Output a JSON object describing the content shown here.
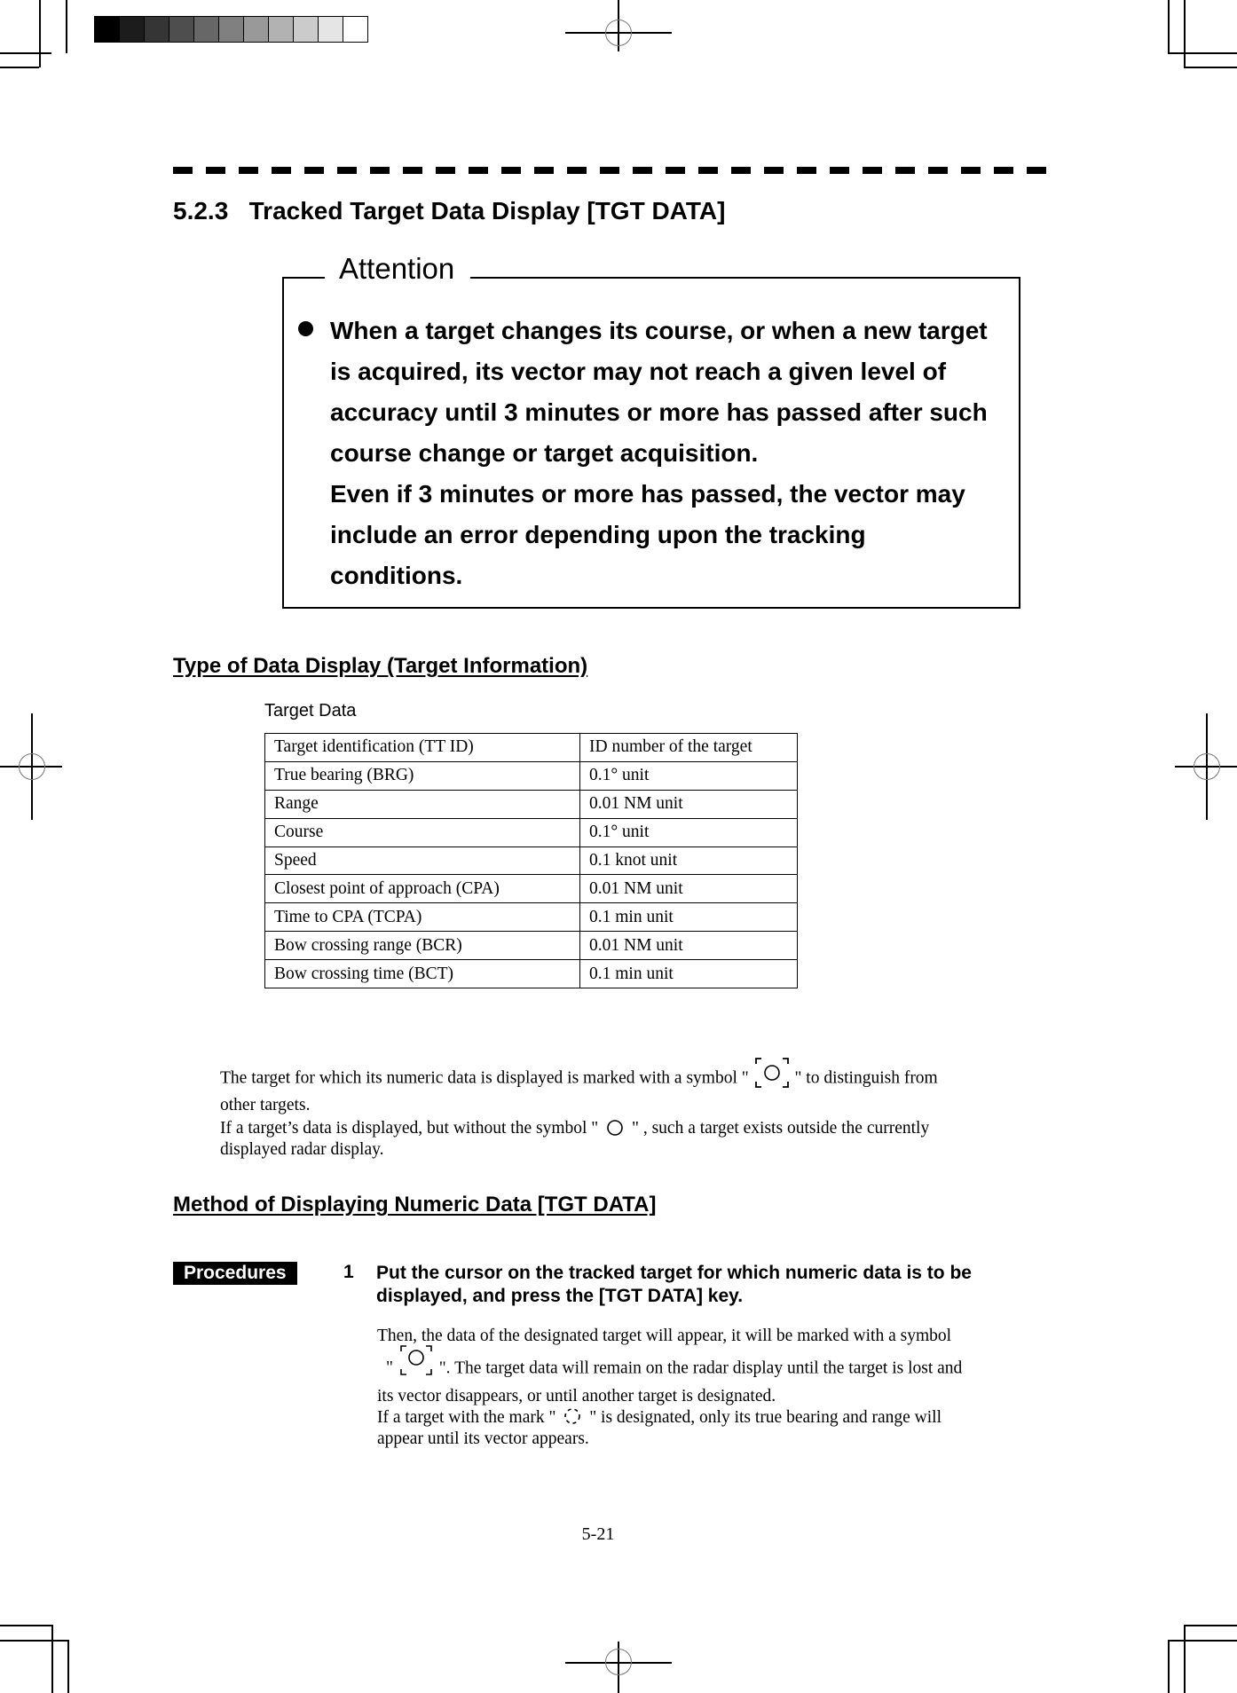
{
  "grayscale_bar": {
    "swatches": [
      "#000000",
      "#1c1c1c",
      "#353535",
      "#4e4e4e",
      "#676767",
      "#808080",
      "#999999",
      "#b2b2b2",
      "#cbcbcb",
      "#e5e5e5",
      "#ffffff"
    ]
  },
  "section": {
    "number": "5.2.3",
    "title": "Tracked Target Data Display [TGT DATA]"
  },
  "attention": {
    "label": "Attention",
    "lines": [
      "When a target changes its course, or when a new target",
      "is acquired, its vector may not reach a given level of",
      "accuracy until 3 minutes or more has passed after such",
      "course change or target acquisition.",
      "Even if 3 minutes or more has passed, the vector may",
      "include an error depending upon the tracking",
      "conditions."
    ]
  },
  "data_display": {
    "heading": "Type of Data Display (Target Information)",
    "caption": "Target Data",
    "rows": [
      {
        "item": "Target identification (TT ID)",
        "value": "ID number of the target"
      },
      {
        "item": "True bearing (BRG)",
        "value": "0.1° unit"
      },
      {
        "item": "Range",
        "value": "0.01 NM unit"
      },
      {
        "item": "Course",
        "value": "0.1° unit"
      },
      {
        "item": "Speed",
        "value": "0.1 knot unit"
      },
      {
        "item": "Closest point of approach (CPA)",
        "value": "0.01 NM unit"
      },
      {
        "item": "Time to CPA (TCPA)",
        "value": "0.1 min unit"
      },
      {
        "item": "Bow crossing range (BCR)",
        "value": "0.01 NM unit"
      },
      {
        "item": "Bow crossing time (BCT)",
        "value": "0.1 min unit"
      }
    ],
    "note": {
      "line1_a": "The target for which its numeric data is displayed is marked with a symbol \"",
      "line1_b": "\" to distinguish from",
      "line2": "other targets.",
      "line3_a": "If a target’s data is displayed, but without the symbol \"",
      "line3_b": "\" , such a target exists outside the currently",
      "line4": "displayed radar display.",
      "symbol_bracketed": "selected-target-symbol",
      "symbol_plain": "tracked-target-symbol"
    }
  },
  "method": {
    "heading": "Method of Displaying Numeric Data [TGT DATA]",
    "badge": "Procedures",
    "steps": [
      {
        "number": "1",
        "instruction": "Put the cursor on the tracked target for which numeric data is to be displayed, and press the [TGT DATA] key.",
        "detail": {
          "line1": "Then, the data of the designated target will appear, it will be marked with a symbol",
          "line2_a": "\"",
          "line2_b": "\".    The target data will remain on the radar display until the target is lost and",
          "line3": "its vector disappears, or until another target is designated.",
          "line4_a": "If a target with the mark \"",
          "line4_b": "\" is designated, only its true bearing and range will",
          "line5": "appear until its vector appears.",
          "symbol_dashed": "acquiring-target-symbol"
        }
      }
    ]
  },
  "footer": {
    "page_number": "5-21"
  }
}
